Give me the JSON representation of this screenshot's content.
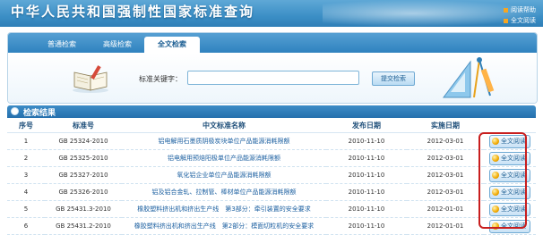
{
  "header": {
    "title": "中华人民共和国强制性国家标准查询",
    "links": [
      "阅读帮助",
      "全文阅读"
    ]
  },
  "tabs": [
    {
      "label": "普通检索",
      "active": false
    },
    {
      "label": "高级检索",
      "active": false
    },
    {
      "label": "全文检索",
      "active": true
    }
  ],
  "search": {
    "keyword_label": "标准关键字：",
    "keyword_value": "",
    "submit_label": "提交检索"
  },
  "results": {
    "title": "检索结果",
    "columns": [
      "序号",
      "标准号",
      "中文标准名称",
      "发布日期",
      "实施日期",
      ""
    ],
    "rows": [
      {
        "no": "1",
        "code": "GB 25324-2010",
        "name": "铝电解用石墨质阴极炭块单位产品能源消耗限额",
        "pub": "2010-11-10",
        "impl": "2012-03-01",
        "action": "全文阅读"
      },
      {
        "no": "2",
        "code": "GB 25325-2010",
        "name": "铝电解用预焙阳极单位产品能源消耗限额",
        "pub": "2010-11-10",
        "impl": "2012-03-01",
        "action": "全文阅读"
      },
      {
        "no": "3",
        "code": "GB 25327-2010",
        "name": "氧化铝企业单位产品能源消耗限额",
        "pub": "2010-11-10",
        "impl": "2012-03-01",
        "action": "全文阅读"
      },
      {
        "no": "4",
        "code": "GB 25326-2010",
        "name": "铝及铝合金轧、拉制管、棒材单位产品能源消耗限额",
        "pub": "2010-11-10",
        "impl": "2012-03-01",
        "action": "全文阅读"
      },
      {
        "no": "5",
        "code": "GB 25431.3-2010",
        "name": "橡胶塑料挤出机和挤出生产线　第3部分：牵引装置的安全要求",
        "pub": "2010-11-10",
        "impl": "2012-01-01",
        "action": "全文阅读"
      },
      {
        "no": "6",
        "code": "GB 25431.2-2010",
        "name": "橡胶塑料挤出机和挤出生产线　第2部分：模面切粒机的安全要求",
        "pub": "2010-11-10",
        "impl": "2012-01-01",
        "action": "全文阅读"
      }
    ]
  },
  "colors": {
    "header_blue": "#3c8fc6",
    "link_blue": "#1b5fa0",
    "highlight_red": "#c81e1e"
  }
}
